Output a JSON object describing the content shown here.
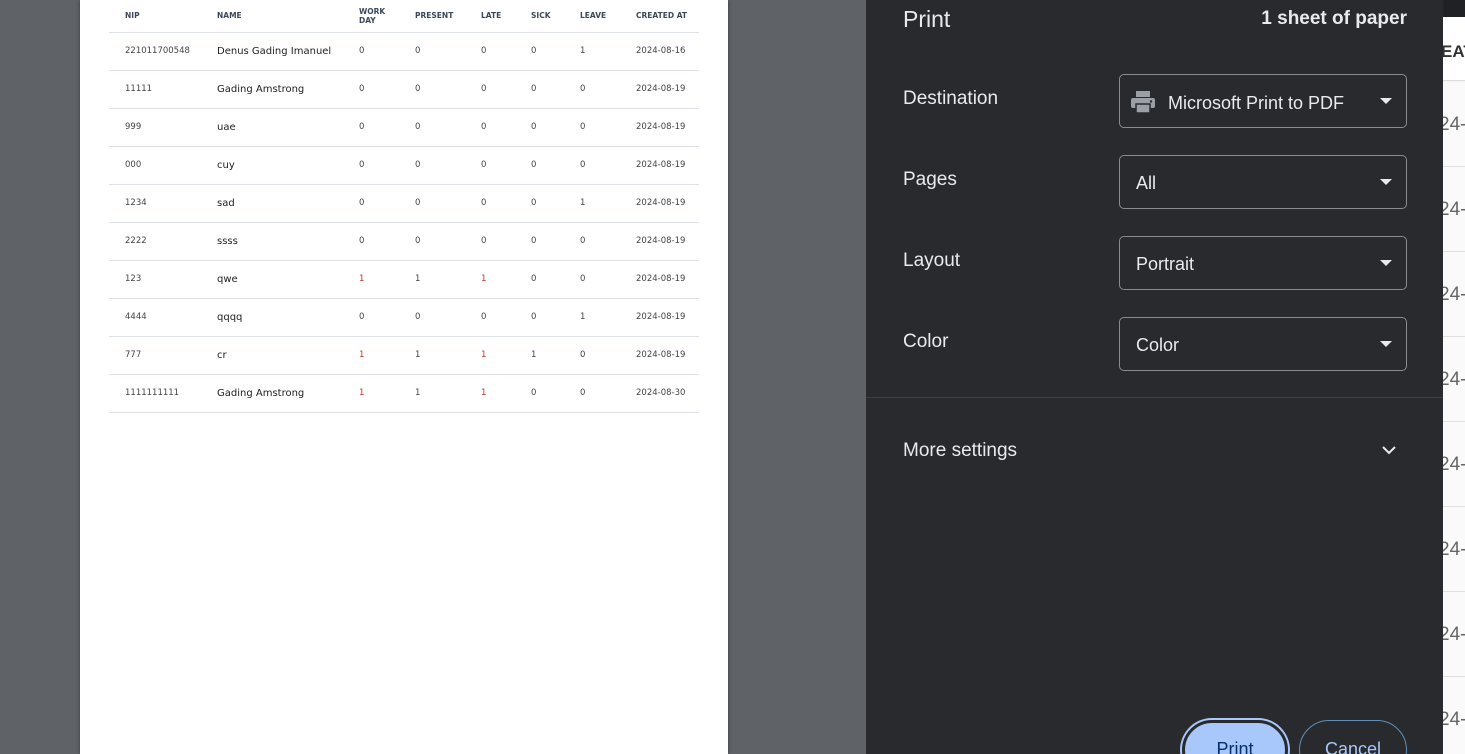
{
  "table": {
    "headers": [
      "NIP",
      "NAME",
      "WORK\nDAY",
      "PRESENT",
      "LATE",
      "SICK",
      "LEAVE",
      "CREATED AT"
    ],
    "rows": [
      [
        "221011700548",
        "Denus Gading Imanuel",
        "0",
        "0",
        "0",
        "0",
        "1",
        "2024-08-16"
      ],
      [
        "11111",
        "Gading Amstrong",
        "0",
        "0",
        "0",
        "0",
        "0",
        "2024-08-19"
      ],
      [
        "999",
        "uae",
        "0",
        "0",
        "0",
        "0",
        "0",
        "2024-08-19"
      ],
      [
        "000",
        "cuy",
        "0",
        "0",
        "0",
        "0",
        "0",
        "2024-08-19"
      ],
      [
        "1234",
        "sad",
        "0",
        "0",
        "0",
        "0",
        "1",
        "2024-08-19"
      ],
      [
        "2222",
        "ssss",
        "0",
        "0",
        "0",
        "0",
        "0",
        "2024-08-19"
      ],
      [
        "123",
        "qwe",
        "1",
        "1",
        "1",
        "0",
        "0",
        "2024-08-19"
      ],
      [
        "4444",
        "qqqq",
        "0",
        "0",
        "0",
        "0",
        "1",
        "2024-08-19"
      ],
      [
        "777",
        "cr",
        "1",
        "1",
        "1",
        "1",
        "0",
        "2024-08-19"
      ],
      [
        "1111111111",
        "Gading Amstrong",
        "1",
        "1",
        "1",
        "0",
        "0",
        "2024-08-30"
      ]
    ]
  },
  "dialog": {
    "title": "Print",
    "sheet_count": "1 sheet of paper",
    "destination": {
      "label": "Destination",
      "value": "Microsoft Print to PDF"
    },
    "pages": {
      "label": "Pages",
      "value": "All"
    },
    "layout": {
      "label": "Layout",
      "value": "Portrait"
    },
    "color": {
      "label": "Color",
      "value": "Color"
    },
    "more_settings": "More settings",
    "print_button": "Print",
    "cancel_button": "Cancel"
  },
  "background": {
    "header_fragment": "EAT",
    "row_fragments": [
      "24-",
      "24-",
      "24-",
      "24-",
      "24-",
      "24-",
      "24-",
      "24-"
    ]
  },
  "colors": {
    "dialog_bg": "#292a2d",
    "accent": "#a8c7fa",
    "highlight_value": "#c0392b"
  }
}
